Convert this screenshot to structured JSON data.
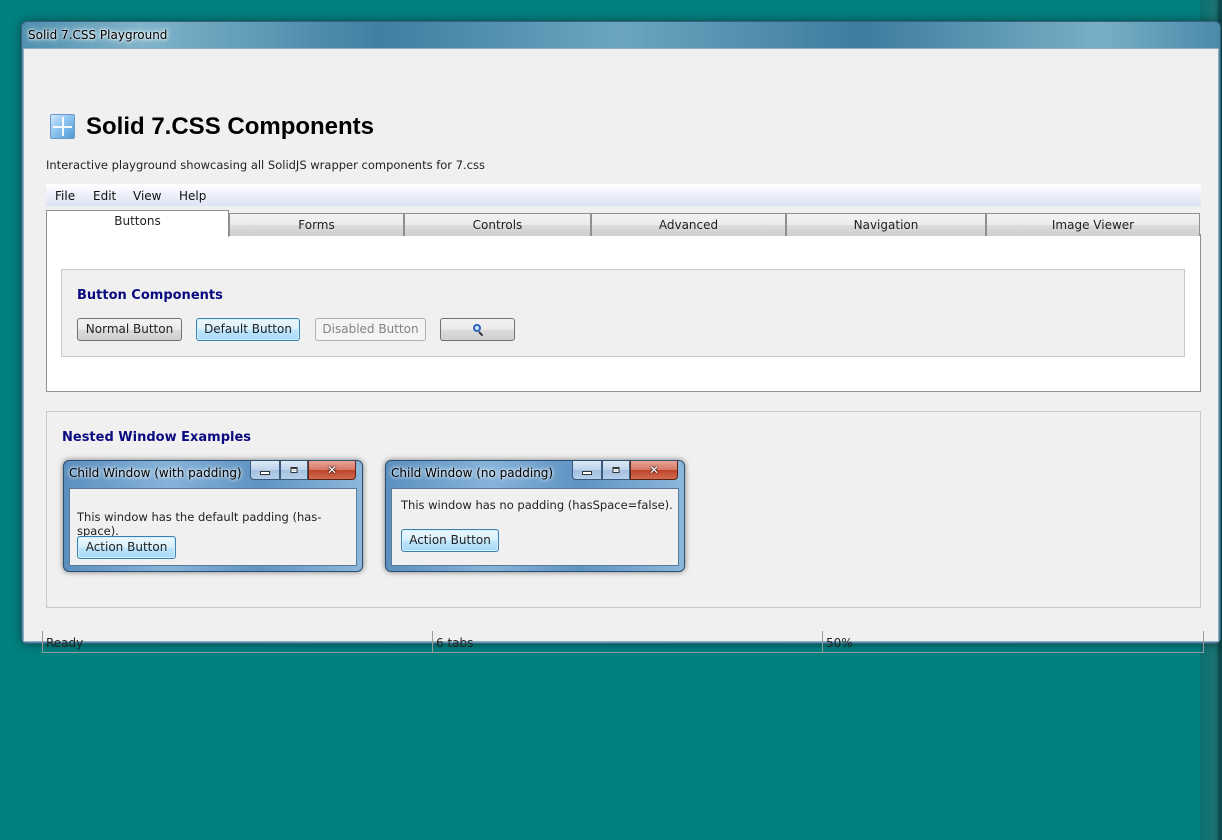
{
  "window": {
    "title": "Solid 7.CSS Playground"
  },
  "header": {
    "title": "Solid 7.CSS Components",
    "subtitle": "Interactive playground showcasing all SolidJS wrapper components for 7.css",
    "icon": "windows-logo-icon"
  },
  "menubar": {
    "items": [
      "File",
      "Edit",
      "View",
      "Help"
    ]
  },
  "tabs": {
    "items": [
      "Buttons",
      "Forms",
      "Controls",
      "Advanced",
      "Navigation",
      "Image Viewer"
    ],
    "active": "Buttons"
  },
  "button_section": {
    "legend": "Button Components",
    "normal_label": "Normal Button",
    "default_label": "Default Button",
    "disabled_label": "Disabled Button",
    "icon_button_icon": "search-icon"
  },
  "nested_section": {
    "legend": "Nested Window Examples",
    "windows": [
      {
        "title": "Child Window (with padding)",
        "text": "This window has the default padding (has-space).",
        "button": "Action Button"
      },
      {
        "title": "Child Window (no padding)",
        "text": "This window has no padding (hasSpace=false).",
        "button": "Action Button"
      }
    ],
    "controls": {
      "minimize": "",
      "maximize": "",
      "close": "✕"
    }
  },
  "statusbar": {
    "fields": [
      "Ready",
      "6 tabs",
      "50%"
    ]
  },
  "colors": {
    "desktop": "#008080",
    "legend": "#0a0a80",
    "default_button": "#bee6fd",
    "close_button": "#c1432a"
  }
}
